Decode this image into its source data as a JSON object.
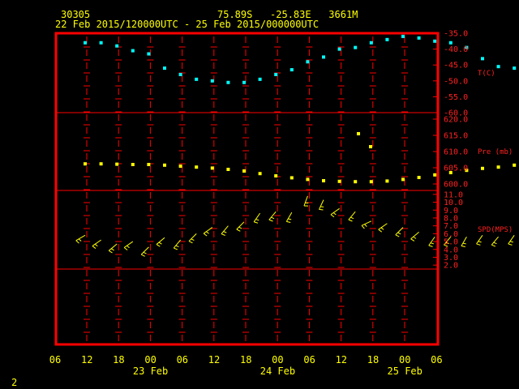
{
  "header": {
    "station_id": "30305",
    "location": "75.89S   -25.83E   3661M",
    "time_range": "22 Feb 2015/120000UTC - 25 Feb 2015/000000UTC"
  },
  "footer": {
    "page_number": "2"
  },
  "colors": {
    "frame": "#ff0000",
    "text": "#ffff00",
    "axis_labels": "#ff2020",
    "temperature": "#00ffff",
    "pressure": "#ffff00",
    "wind": "#ffff00"
  },
  "chart_data": [
    {
      "type": "scatter",
      "panel": "temperature",
      "ylabel": "T(C)",
      "ylim": [
        -60,
        -35
      ],
      "yticks": [
        "-35.0",
        "-40.0",
        "-45.0",
        "-50.0",
        "-55.0",
        "-60.0"
      ],
      "x": [
        10,
        11,
        12,
        13,
        14,
        15,
        16,
        17,
        18,
        19,
        20,
        21,
        22,
        23,
        24,
        25,
        26,
        27,
        28,
        29,
        30,
        31,
        32,
        33,
        34,
        35,
        36,
        37,
        38,
        39,
        40,
        41,
        42,
        43,
        44,
        45,
        46,
        47,
        48,
        49,
        50,
        51,
        52,
        53,
        54,
        55,
        56,
        57
      ],
      "values": [
        -38.0,
        -38.0,
        -39.0,
        -40.5,
        -41.5,
        -46.0,
        -48.0,
        -49.5,
        -50.0,
        -50.5,
        -50.5,
        -49.5,
        -48.0,
        -46.5,
        -44.0,
        -42.5,
        -40.0,
        -39.5,
        -38.0,
        -37.0,
        -36.0,
        -36.5,
        -37.5,
        -38.0,
        -39.5,
        -43.0,
        -45.5,
        -46.0,
        -45.0,
        -43.5,
        -41.0,
        -39.0,
        -38.0,
        -37.0,
        -36.0,
        -35.5,
        -34.5,
        -35.5,
        -36.0,
        -37.0,
        -38.5,
        -39.0,
        -39.5,
        -40.0,
        -41.0,
        -42.0,
        -42.5,
        -43.0
      ]
    },
    {
      "type": "scatter",
      "panel": "pressure",
      "ylabel": "Pre (mb)",
      "ylim": [
        598,
        622
      ],
      "yticks": [
        "620.0",
        "615.0",
        "610.0",
        "605.0",
        "600.0"
      ],
      "x": [
        10,
        11,
        12,
        13,
        14,
        15,
        16,
        17,
        18,
        19,
        20,
        21,
        22,
        23,
        24,
        25,
        26,
        27,
        28,
        29,
        30,
        31,
        32,
        33,
        34,
        35,
        36,
        37,
        38,
        39,
        40,
        41,
        42,
        43,
        44,
        45,
        46,
        47,
        48,
        49,
        50,
        51,
        52,
        53,
        54,
        55,
        56,
        57
      ],
      "values": [
        606.2,
        606.2,
        606.1,
        606.0,
        606.0,
        605.8,
        605.5,
        605.2,
        604.9,
        604.5,
        604.0,
        603.2,
        602.5,
        601.9,
        601.4,
        601.0,
        600.8,
        600.7,
        600.7,
        600.9,
        601.4,
        602.0,
        602.8,
        603.5,
        604.2,
        604.8,
        605.2,
        605.8,
        606.2,
        606.8,
        607.5,
        608.2,
        608.8,
        609.5,
        610.0,
        610.5,
        611.2,
        611.7,
        612.2,
        612.8,
        613.3,
        613.8,
        614.2,
        614.6,
        615.0,
        615.4,
        615.7,
        615.9
      ]
    },
    {
      "type": "scatter",
      "panel": "wind",
      "ylabel": "SPD(MPS)",
      "ylim": [
        1.5,
        11.5
      ],
      "yticks": [
        "11.0",
        "10.0",
        "9.0",
        "8.0",
        "7.0",
        "6.0",
        "5.0",
        "4.0",
        "3.0",
        "2.0"
      ],
      "x": [
        10,
        11,
        12,
        13,
        14,
        15,
        16,
        17,
        18,
        19,
        20,
        21,
        22,
        23,
        24,
        25,
        26,
        27,
        28,
        29,
        30,
        31,
        32,
        33,
        34,
        35,
        36,
        37,
        38,
        39,
        40,
        41,
        42,
        43,
        44,
        45,
        46,
        47,
        48,
        49,
        50
      ],
      "values": [
        5.8,
        5.2,
        4.7,
        5.0,
        4.3,
        5.5,
        5.2,
        6.0,
        6.8,
        7.0,
        7.5,
        8.6,
        8.8,
        8.7,
        10.8,
        10.3,
        9.2,
        8.8,
        7.6,
        7.3,
        6.8,
        6.2,
        5.6,
        5.6,
        5.6,
        5.8,
        5.6,
        5.8,
        5.7,
        6.2,
        6.7,
        6.2,
        5.8,
        3.5,
        3.3,
        3.0,
        2.9,
        2.8,
        2.4,
        2.5,
        2.3
      ],
      "direction_deg": [
        210,
        215,
        220,
        215,
        225,
        220,
        230,
        225,
        215,
        230,
        225,
        235,
        230,
        240,
        250,
        245,
        215,
        230,
        205,
        215,
        225,
        220,
        235,
        230,
        240,
        235,
        230,
        235,
        240,
        210,
        205,
        200,
        210,
        215,
        210,
        215,
        220,
        215,
        225,
        220,
        230
      ]
    }
  ],
  "x_axis": {
    "tick_labels": [
      "06",
      "12",
      "18",
      "00",
      "06",
      "12",
      "18",
      "00",
      "06",
      "12",
      "18",
      "00",
      "06"
    ],
    "date_labels": [
      {
        "label": "23 Feb",
        "tick_index": 3
      },
      {
        "label": "24 Feb",
        "tick_index": 7
      },
      {
        "label": "25 Feb",
        "tick_index": 11
      }
    ]
  }
}
